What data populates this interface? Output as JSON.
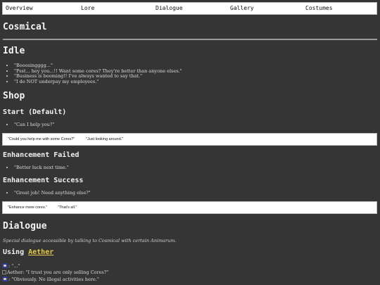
{
  "nav": {
    "items": [
      "Overview",
      "Lore",
      "Dialogue",
      "Gallery",
      "Costumes"
    ]
  },
  "page": {
    "title": "Cosmical"
  },
  "idle": {
    "heading": "Idle",
    "lines": [
      "\"Booosingggg...\"",
      "\"Psst... hey you...!! Want some cores? They're better than anyone elses.\"",
      "\"Business is booming!! I've always wanted to say that.\"",
      "\"I do NOT underpay my employees.\""
    ]
  },
  "shop": {
    "heading": "Shop",
    "start": {
      "heading": "Start (Default)",
      "lines": [
        "\"Can I help you?\""
      ],
      "choices": [
        "\"Could you help me with some Cores?\"",
        "\"Just looking around.\""
      ]
    },
    "failed": {
      "heading": "Enhancement Failed",
      "lines": [
        "\"Better luck next time.\""
      ]
    },
    "success": {
      "heading": "Enhancement Success",
      "lines": [
        "\"Great job! Need anything else?\""
      ],
      "choices": [
        "\"Enhance more cores.\"",
        "\"That's all.\""
      ]
    }
  },
  "dialogue": {
    "heading": "Dialogue",
    "description": "Special dialogue accessible by talking to Cosmical with certain Animarum.",
    "using_prefix": "Using ",
    "using_link": "Aether",
    "lines": [
      ": \"...\"",
      "Aether: \"I trust you are only selling Cores?\"",
      ": \"Obviously. No illegal activities here.\""
    ]
  }
}
